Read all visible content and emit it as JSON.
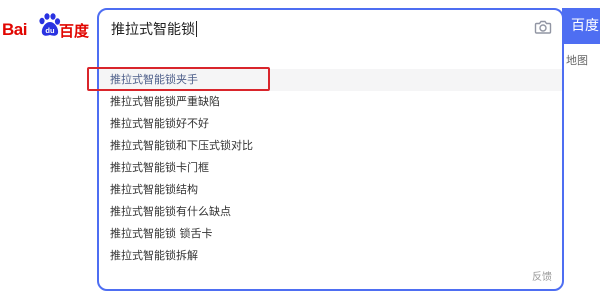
{
  "logo": {
    "text_left": "Bai",
    "text_right": "百度",
    "brand_color": "#e10601",
    "paw_icon": "baidu-paw-icon"
  },
  "search": {
    "query": "推拉式智能锁",
    "camera_icon": "camera-icon",
    "button_label": "百度",
    "accent_color": "#4e6ef2"
  },
  "suggestions": [
    "推拉式智能锁夹手",
    "推拉式智能锁严重缺陷",
    "推拉式智能锁好不好",
    "推拉式智能锁和下压式锁对比",
    "推拉式智能锁卡门框",
    "推拉式智能锁结构",
    "推拉式智能锁有什么缺点",
    "推拉式智能锁 锁舌卡",
    "推拉式智能锁拆解"
  ],
  "feedback_label": "反馈",
  "side_links": {
    "map": "地图"
  },
  "annotation_color": "#d9252b"
}
